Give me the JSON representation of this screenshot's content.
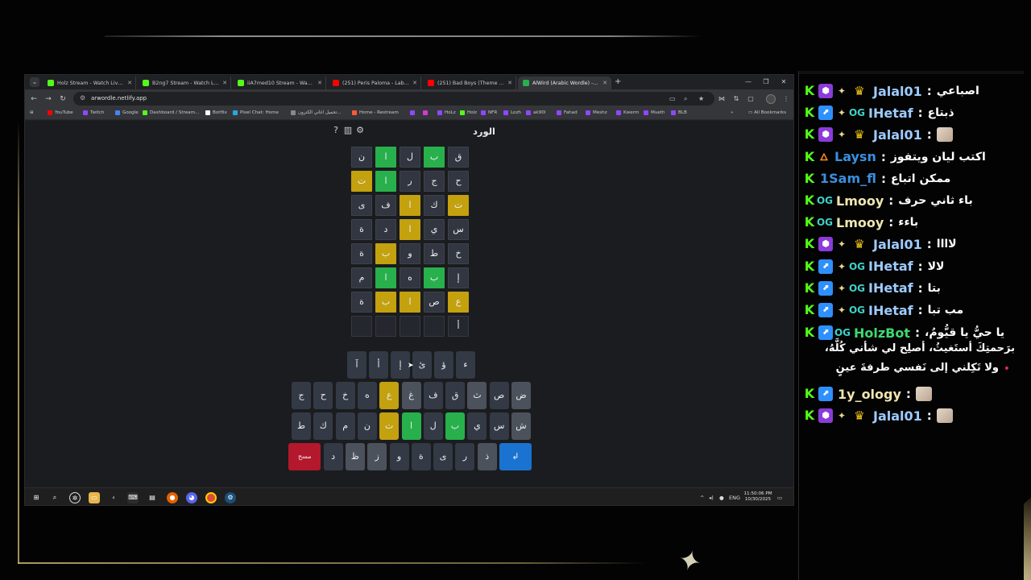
{
  "browser": {
    "tabs": [
      {
        "title": "Holz Stream - Watch Live on Ki",
        "icon": "kick-icon",
        "color": "#53fc18"
      },
      {
        "title": "B2ng7 Stream - Watch Live on",
        "icon": "kick-icon",
        "color": "#53fc18"
      },
      {
        "title": "iiA7med10 Stream - Watch Liv",
        "icon": "kick-icon",
        "color": "#53fc18"
      },
      {
        "title": "(251) Peris Paloma - Labour - Y",
        "icon": "youtube-icon",
        "color": "#ff0000"
      },
      {
        "title": "(251) Bad Boys (Theme from Co",
        "icon": "youtube-icon",
        "color": "#ff0000"
      },
      {
        "title": "AlWird (Arabic Wordle) - الورد",
        "icon": "wordle-icon",
        "color": "#27b04b"
      }
    ],
    "url": "arwordle.netlify.app",
    "bookmarks": [
      {
        "label": "YouTube",
        "color": "#ff0000"
      },
      {
        "label": "Twitch",
        "color": "#9146ff"
      },
      {
        "label": "Google",
        "color": "#4285f4"
      },
      {
        "label": "Dashboard / Stream...",
        "color": "#53fc18"
      },
      {
        "label": "Botfilx",
        "color": "#ffffff"
      },
      {
        "label": "Pixel Chat: Home",
        "color": "#2aa7e0"
      },
      {
        "label": "تحميل اغاني الكترون...",
        "color": "#888888"
      },
      {
        "label": "Home - Restream",
        "color": "#ff5a36"
      },
      {
        "label": "",
        "color": "#9146ff"
      },
      {
        "label": "",
        "color": "#d23ad2"
      },
      {
        "label": "HoLz",
        "color": "#9146ff"
      },
      {
        "label": "Holz",
        "color": "#53fc18"
      },
      {
        "label": "NFR",
        "color": "#9146ff"
      },
      {
        "label": "Lozh",
        "color": "#9146ff"
      },
      {
        "label": "ak90l",
        "color": "#9146ff"
      },
      {
        "label": "Fahad",
        "color": "#9146ff"
      },
      {
        "label": "Meshz",
        "color": "#9146ff"
      },
      {
        "label": "Kwerm",
        "color": "#9146ff"
      },
      {
        "label": "Mueth",
        "color": "#9146ff"
      },
      {
        "label": "BLB",
        "color": "#9146ff"
      }
    ],
    "all_bookmarks": "All Bookmarks"
  },
  "game": {
    "title": "الورد",
    "rows": [
      [
        {
          "l": "ق",
          "s": "absent"
        },
        {
          "l": "ب",
          "s": "correct"
        },
        {
          "l": "ل",
          "s": "absent"
        },
        {
          "l": "ا",
          "s": "correct"
        },
        {
          "l": "ن",
          "s": "absent"
        }
      ],
      [
        {
          "l": "ح",
          "s": "absent"
        },
        {
          "l": "ج",
          "s": "absent"
        },
        {
          "l": "ر",
          "s": "absent"
        },
        {
          "l": "ا",
          "s": "correct"
        },
        {
          "l": "ت",
          "s": "present"
        }
      ],
      [
        {
          "l": "ت",
          "s": "present"
        },
        {
          "l": "ك",
          "s": "absent"
        },
        {
          "l": "ا",
          "s": "present"
        },
        {
          "l": "ف",
          "s": "absent"
        },
        {
          "l": "ى",
          "s": "absent"
        }
      ],
      [
        {
          "l": "س",
          "s": "absent"
        },
        {
          "l": "ي",
          "s": "absent"
        },
        {
          "l": "ا",
          "s": "present"
        },
        {
          "l": "د",
          "s": "absent"
        },
        {
          "l": "ة",
          "s": "absent"
        }
      ],
      [
        {
          "l": "خ",
          "s": "absent"
        },
        {
          "l": "ط",
          "s": "absent"
        },
        {
          "l": "و",
          "s": "absent"
        },
        {
          "l": "ب",
          "s": "present"
        },
        {
          "l": "ة",
          "s": "absent"
        }
      ],
      [
        {
          "l": "إ",
          "s": "absent"
        },
        {
          "l": "ب",
          "s": "correct"
        },
        {
          "l": "ه",
          "s": "absent"
        },
        {
          "l": "ا",
          "s": "correct"
        },
        {
          "l": "م",
          "s": "absent"
        }
      ],
      [
        {
          "l": "ع",
          "s": "present"
        },
        {
          "l": "ص",
          "s": "absent"
        },
        {
          "l": "ا",
          "s": "present"
        },
        {
          "l": "ب",
          "s": "present"
        },
        {
          "l": "ة",
          "s": "absent"
        }
      ],
      [
        {
          "l": "أ",
          "s": "empty"
        },
        {
          "l": "",
          "s": "empty"
        },
        {
          "l": "",
          "s": "empty"
        },
        {
          "l": "",
          "s": "empty"
        },
        {
          "l": "",
          "s": "empty"
        }
      ]
    ],
    "keyboard": [
      [
        {
          "l": "ء",
          "s": "unused"
        },
        {
          "l": "ؤ",
          "s": "unused"
        },
        {
          "l": "ئ",
          "s": "unused"
        },
        {
          "l": "إ",
          "s": "unused"
        },
        {
          "l": "أ",
          "s": "unused"
        },
        {
          "l": "آ",
          "s": "unused"
        }
      ],
      [
        {
          "l": "ض",
          "s": "absent"
        },
        {
          "l": "ص",
          "s": "unused"
        },
        {
          "l": "ث",
          "s": "absent"
        },
        {
          "l": "ق",
          "s": "unused"
        },
        {
          "l": "ف",
          "s": "unused"
        },
        {
          "l": "غ",
          "s": "absent"
        },
        {
          "l": "ع",
          "s": "present"
        },
        {
          "l": "ه",
          "s": "unused"
        },
        {
          "l": "خ",
          "s": "unused"
        },
        {
          "l": "ح",
          "s": "unused"
        },
        {
          "l": "ج",
          "s": "unused"
        }
      ],
      [
        {
          "l": "ش",
          "s": "absent"
        },
        {
          "l": "س",
          "s": "unused"
        },
        {
          "l": "ي",
          "s": "unused"
        },
        {
          "l": "ب",
          "s": "correct"
        },
        {
          "l": "ل",
          "s": "unused"
        },
        {
          "l": "ا",
          "s": "correct"
        },
        {
          "l": "ت",
          "s": "present"
        },
        {
          "l": "ن",
          "s": "unused"
        },
        {
          "l": "م",
          "s": "unused"
        },
        {
          "l": "ك",
          "s": "unused"
        },
        {
          "l": "ط",
          "s": "unused"
        }
      ],
      [
        {
          "l": "↲",
          "s": "enter"
        },
        {
          "l": "ذ",
          "s": "absent"
        },
        {
          "l": "ر",
          "s": "unused"
        },
        {
          "l": "ى",
          "s": "unused"
        },
        {
          "l": "ة",
          "s": "unused"
        },
        {
          "l": "و",
          "s": "unused"
        },
        {
          "l": "ز",
          "s": "absent"
        },
        {
          "l": "ظ",
          "s": "absent"
        },
        {
          "l": "د",
          "s": "unused"
        },
        {
          "l": "مسح",
          "s": "del"
        }
      ]
    ],
    "colors": {
      "correct": "#27b04b",
      "present": "#c3a10f",
      "absent": "#313640"
    }
  },
  "taskbar": {
    "time": "11:50:06 PM",
    "date": "10/30/2025",
    "lang": "ENG"
  },
  "chat": {
    "messages": [
      {
        "badges": [
          "kick",
          "sub",
          "spark",
          "crown"
        ],
        "user": "Jalal01",
        "color": "#9ecbff",
        "text": "اصباعي"
      },
      {
        "badges": [
          "kick",
          "prime",
          "spark",
          "og"
        ],
        "user": "IHetaf",
        "color": "#9ecbff",
        "text": "ذبتاع"
      },
      {
        "badges": [
          "kick",
          "sub",
          "spark",
          "crown"
        ],
        "user": "Jalal01",
        "color": "#9ecbff",
        "text": "",
        "emote": true
      },
      {
        "badges": [
          "kick",
          "flame"
        ],
        "user": "Laysn",
        "color": "#3a8fe0",
        "text": "اكتب ليان ويتفوز"
      },
      {
        "badges": [
          "kick"
        ],
        "user": "1Sam_fl",
        "color": "#3a8fe0",
        "text": "ممكن اتباع"
      },
      {
        "badges": [
          "kick",
          "og"
        ],
        "user": "Lmooy",
        "color": "#f0e6b0",
        "text": "باء ثاني حرف"
      },
      {
        "badges": [
          "kick",
          "og"
        ],
        "user": "Lmooy",
        "color": "#f0e6b0",
        "text": "باءء"
      },
      {
        "badges": [
          "kick",
          "sub",
          "spark",
          "crown"
        ],
        "user": "Jalal01",
        "color": "#9ecbff",
        "text": "لاااا"
      },
      {
        "badges": [
          "kick",
          "prime",
          "spark",
          "og"
        ],
        "user": "IHetaf",
        "color": "#9ecbff",
        "text": "لالا"
      },
      {
        "badges": [
          "kick",
          "prime",
          "spark",
          "og"
        ],
        "user": "IHetaf",
        "color": "#9ecbff",
        "text": "بتا"
      },
      {
        "badges": [
          "kick",
          "prime",
          "spark",
          "og"
        ],
        "user": "IHetaf",
        "color": "#9ecbff",
        "text": "مب تبا"
      }
    ],
    "bot": {
      "badges": [
        "kick",
        "prime",
        "og"
      ],
      "user": "HolzBot",
      "color": "#3fd86f",
      "line1": "يا حيُّ يا قيُّومُ،",
      "line2": "برَحمتِكَ أستَغيثُ، أصلِح لي شأني كُلَّهُ،",
      "line3": "ولا تَكِلني إلى نَفسي طرفةَ عينٍ"
    },
    "after": [
      {
        "badges": [
          "kick",
          "prime"
        ],
        "user": "1y_ology",
        "color": "#f0e6b0",
        "text": "",
        "emote": true
      },
      {
        "badges": [
          "kick",
          "sub",
          "spark",
          "crown"
        ],
        "user": "Jalal01",
        "color": "#9ecbff",
        "text": "",
        "emote": true
      }
    ]
  }
}
